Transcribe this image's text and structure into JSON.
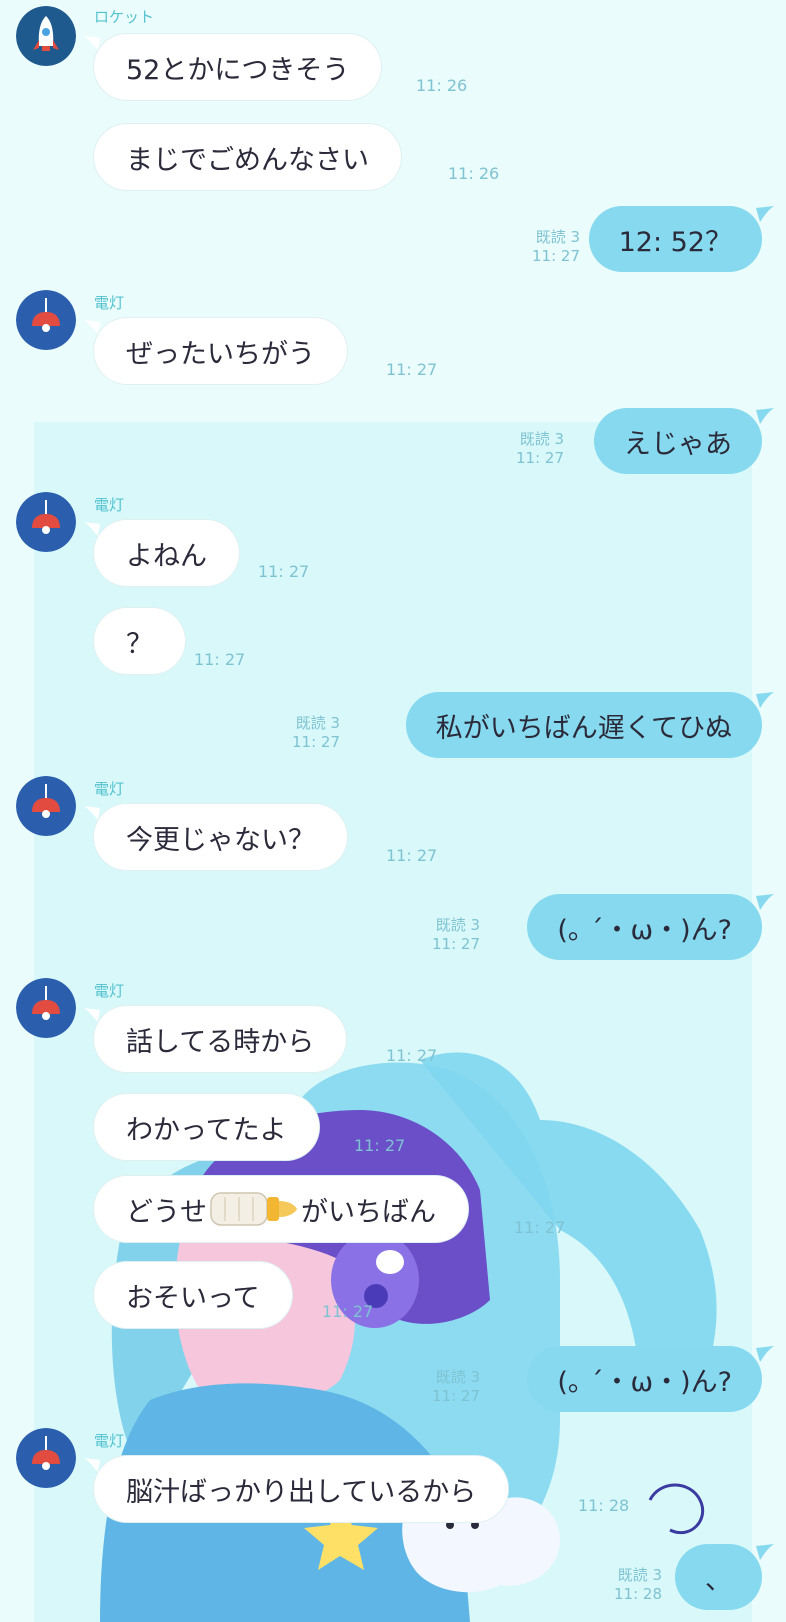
{
  "colors": {
    "background": "#eafcfc",
    "panel": "#d8f8fa",
    "bubble_in": "#ffffff",
    "bubble_out": "#86d9ee",
    "meta_text": "#7fc3d2",
    "sender_text": "#54c2cf"
  },
  "icons": {
    "rocket": "rocket-icon",
    "lamp": "lamp-icon",
    "bottle": "baby-bottle-emoji"
  },
  "m": {
    "s_rocket": "ロケット",
    "m1": "52とかにつきそう",
    "t1": "11: 26",
    "m2": "まじでごめんなさい",
    "t2": "11: 26",
    "r1": "既読 3",
    "rt1": "11: 27",
    "o1": "12: 52？",
    "s2": "電灯",
    "m3": "ぜったいちがう",
    "t3": "11: 27",
    "r2": "既読 3",
    "rt2": "11: 27",
    "o2": "えじゃあ",
    "s3": "電灯",
    "m4": "よねん",
    "t4": "11: 27",
    "m5": "？",
    "t5": "11: 27",
    "r3": "既読 3",
    "rt3": "11: 27",
    "o3": "私がいちばん遅くてひぬ",
    "s4": "電灯",
    "m6": "今更じゃない？",
    "t6": "11: 27",
    "r4": "既読 3",
    "rt4": "11: 27",
    "o4": "(｡ ´・ω・)ん?",
    "s5": "電灯",
    "m7": "話してる時から",
    "t7": "11: 27",
    "m8": "わかってたよ",
    "t8": "11: 27",
    "m9a": "どうせ",
    "m9b": "がいちばん",
    "t9": "11: 27",
    "m10": "おそいって",
    "t10": "11: 27",
    "r5": "既読 3",
    "rt5": "11: 27",
    "o5": "(｡ ´・ω・)ん?",
    "s6": "電灯",
    "m11": "脳汁ばっかり出しているから",
    "t11": "11: 28",
    "r6": "既読 3",
    "rt6": "11: 28",
    "o6": "、"
  }
}
